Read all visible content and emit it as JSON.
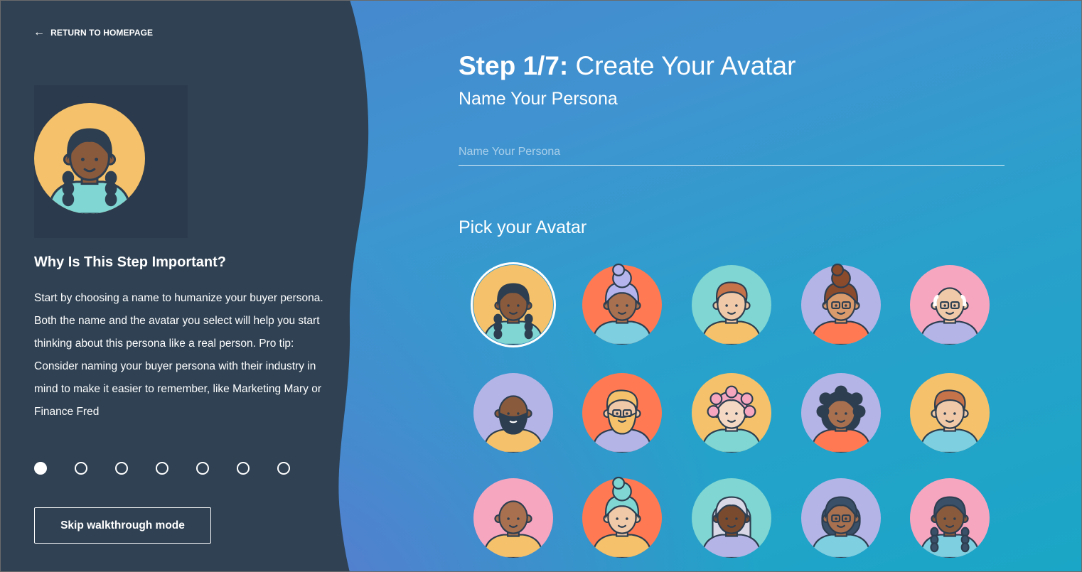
{
  "nav": {
    "back_label": "RETURN TO HOMEPAGE",
    "back_icon": "arrow-left-icon"
  },
  "sidebar": {
    "why_title": "Why Is This Step Important?",
    "why_text": "Start by choosing a name to humanize your buyer persona. Both the name and the avatar you select will help you start thinking about this persona like a real person. Pro tip: Consider naming your buyer persona with their industry in mind to make it easier to remember, like Marketing Mary or Finance Fred",
    "steps_total": 7,
    "steps_current": 1,
    "skip_label": "Skip walkthrough mode"
  },
  "main": {
    "step_label": "Step 1/7:",
    "step_title": " Create Your Avatar",
    "name_heading": "Name Your Persona",
    "name_placeholder": "Name Your Persona",
    "name_value": "",
    "pick_heading": "Pick your Avatar"
  },
  "avatars": [
    {
      "bg": "#f5c26b",
      "skin": "#8a5a3c",
      "hair": "#2d3e50",
      "shirt": "#7fd6d2",
      "style": "braids",
      "selected": true
    },
    {
      "bg": "#ff7a52",
      "skin": "#a8704f",
      "hair": "#b5b4ec",
      "shirt": "#7ecfe0",
      "style": "bun-lilac",
      "selected": false
    },
    {
      "bg": "#7fd6d2",
      "skin": "#f0c9a8",
      "hair": "#c7734a",
      "shirt": "#f5c26b",
      "style": "quiff",
      "selected": false
    },
    {
      "bg": "#b5b4e6",
      "skin": "#d99a6c",
      "hair": "#8a4a2c",
      "shirt": "#ff7a52",
      "style": "curly-bun",
      "glasses": true,
      "selected": false
    },
    {
      "bg": "#f7a6c0",
      "skin": "#f0c9a8",
      "hair": "#ffffff",
      "shirt": "#b5b4e6",
      "style": "bald-old",
      "glasses": true,
      "selected": false
    },
    {
      "bg": "#b5b4e6",
      "skin": "#8a5a3c",
      "hair": "#2d3e50",
      "shirt": "#f5c26b",
      "style": "bald-beard",
      "selected": false
    },
    {
      "bg": "#ff7a52",
      "skin": "#f0c9a8",
      "hair": "#f5c26b",
      "shirt": "#b5b4e6",
      "style": "blonde-beard",
      "glasses": true,
      "selected": false
    },
    {
      "bg": "#f5c26b",
      "skin": "#f4d8c4",
      "hair": "#f7a6c0",
      "shirt": "#7fd6d2",
      "style": "pink-curls",
      "selected": false
    },
    {
      "bg": "#b5b4e6",
      "skin": "#a8704f",
      "hair": "#2d3e50",
      "shirt": "#ff7a52",
      "style": "curly-dark",
      "selected": false
    },
    {
      "bg": "#f5c26b",
      "skin": "#f0c9a8",
      "hair": "#c7734a",
      "shirt": "#7ecfe0",
      "style": "quiff",
      "selected": false
    },
    {
      "bg": "#f7a6c0",
      "skin": "#a8704f",
      "hair": "#a8704f",
      "shirt": "#f5c26b",
      "style": "bald",
      "selected": false
    },
    {
      "bg": "#ff7a52",
      "skin": "#f0c9a8",
      "hair": "#7fd6d2",
      "shirt": "#f5c26b",
      "style": "curly-bun",
      "selected": false
    },
    {
      "bg": "#7fd6d2",
      "skin": "#7a4a2e",
      "hair": "#d8d8e6",
      "shirt": "#b5b4e6",
      "style": "long-grey",
      "selected": false
    },
    {
      "bg": "#b5b4e6",
      "skin": "#a8704f",
      "hair": "#3a5068",
      "shirt": "#7ecfe0",
      "style": "bob",
      "glasses": true,
      "selected": false
    },
    {
      "bg": "#f7a6c0",
      "skin": "#8a5a3c",
      "hair": "#3a5068",
      "shirt": "#7ecfe0",
      "style": "braids",
      "selected": false
    }
  ]
}
